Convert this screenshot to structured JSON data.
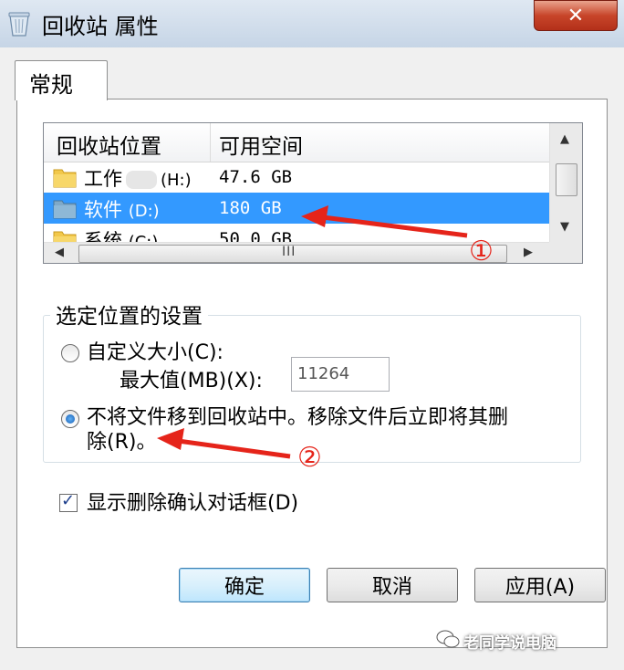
{
  "window": {
    "title": "回收站 属性",
    "close_glyph": "✕"
  },
  "tabs": [
    {
      "label": "常规"
    }
  ],
  "listview": {
    "columns": [
      "回收站位置",
      "可用空间"
    ],
    "rows": [
      {
        "location": "工作",
        "drive": "(H:)",
        "free": "47.6 GB",
        "selected": false,
        "icon": "folder-icon"
      },
      {
        "location": "软件",
        "drive": "(D:)",
        "free": "180 GB",
        "selected": true,
        "icon": "drive-icon"
      },
      {
        "location": "系统",
        "drive": "(C:)",
        "free": "50.0 GB",
        "selected": false,
        "icon": "folder-icon"
      }
    ],
    "hscroll_grip": "III"
  },
  "settings": {
    "group_title": "选定位置的设置",
    "custom_size_label": "自定义大小(C):",
    "max_label": "最大值(MB)(X):",
    "max_value": "11264",
    "no_recycle_line1": "不将文件移到回收站中。移除文件后立即将其删",
    "no_recycle_line2": "除(R)。"
  },
  "confirm_delete": {
    "label": "显示删除确认对话框(D)",
    "checked": true
  },
  "buttons": {
    "ok": "确定",
    "cancel": "取消",
    "apply": "应用(A)"
  },
  "annotations": {
    "one": "①",
    "two": "②"
  },
  "watermark": "老同学说电脑",
  "colors": {
    "selection": "#3399ff",
    "annotation": "#e5241a",
    "close": "#c8452a"
  }
}
